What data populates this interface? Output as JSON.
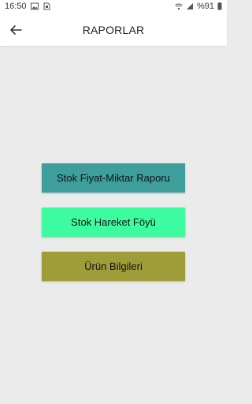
{
  "status_bar": {
    "time": "16:50",
    "battery": "%91"
  },
  "app_bar": {
    "title": "RAPORLAR",
    "back_icon": "arrow-left-icon"
  },
  "buttons": [
    {
      "label": "Stok Fiyat-Miktar Raporu",
      "color": "#3d9e9c"
    },
    {
      "label": "Stok Hareket Föyü",
      "color": "#3dfc9f"
    },
    {
      "label": "Ürün Bilgileri",
      "color": "#9f9c3a"
    }
  ],
  "colors": {
    "background": "#ebebeb",
    "app_bar": "#ffffff"
  }
}
